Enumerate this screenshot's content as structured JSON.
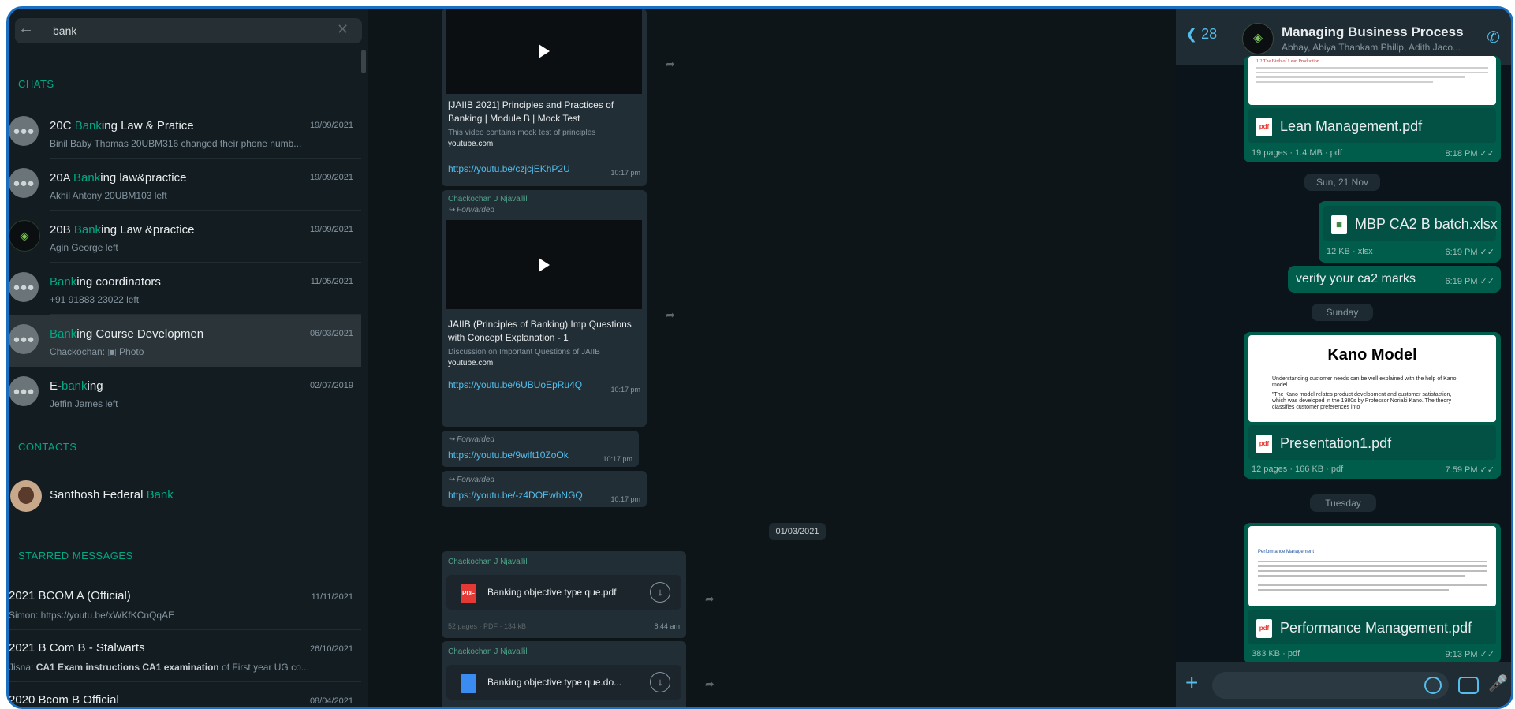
{
  "colors": {
    "accent": "#00a884",
    "link": "#53bdeb",
    "frame": "#1a6fc0",
    "outgoing": "#005c4b"
  },
  "search": {
    "query": "bank"
  },
  "sections": {
    "chats": "CHATS",
    "contacts": "CONTACTS",
    "starred": "STARRED MESSAGES"
  },
  "chats": [
    {
      "pre": "20C ",
      "hl": "Bank",
      "post": "ing Law & Pratice",
      "sub": "Binil Baby Thomas 20UBM316 changed their phone numb...",
      "date": "19/09/2021",
      "avatar": "group-icon"
    },
    {
      "pre": "20A ",
      "hl": "Bank",
      "post": "ing law&practice",
      "sub": "Akhil Antony 20UBM103 left",
      "date": "19/09/2021",
      "avatar": "group-icon"
    },
    {
      "pre": "20B ",
      "hl": "Bank",
      "post": "ing Law &practice",
      "sub": "Agin George left",
      "date": "19/09/2021",
      "avatar": "logo-icon"
    },
    {
      "pre": "",
      "hl": "Bank",
      "post": "ing coordinators",
      "sub": "+91 91883 23022 left",
      "date": "11/05/2021",
      "avatar": "group-icon"
    },
    {
      "pre": "",
      "hl": "Bank",
      "post": "ing Course Developmen",
      "sub": "Chackochan: ▣ Photo",
      "date": "06/03/2021",
      "avatar": "group-icon"
    },
    {
      "pre": "E-",
      "hl": "bank",
      "post": "ing",
      "sub": "Jeffin James left",
      "date": "02/07/2019",
      "avatar": "group-icon"
    }
  ],
  "contacts": [
    {
      "pre": "Santhosh Federal ",
      "hl": "Bank"
    }
  ],
  "starred": [
    {
      "title": "2021 BCOM A (Official)",
      "sub_pre": "Simon: https://youtu.be/xWKfKCnQqAE",
      "sub_bold": "",
      "sub_post": "",
      "date": "11/11/2021"
    },
    {
      "title": "2021 B Com B - Stalwarts",
      "sub_pre": "Jisna: ",
      "sub_bold": "CA1 Exam instructions  CA1 examination",
      "sub_post": " of First year UG co...",
      "date": "26/10/2021"
    },
    {
      "title": "2020 Bcom B Official",
      "sub_pre": "",
      "sub_bold": "",
      "sub_post": "",
      "date": "08/04/2021"
    }
  ],
  "middle": {
    "msg1": {
      "title": "[JAIIB 2021] Principles and Practices of Banking | Module B | Mock Test",
      "desc": "This video contains mock test of principles",
      "site": "youtube.com",
      "link": "https://youtu.be/czjcjEKhP2U",
      "time": "10:17 pm"
    },
    "msg2": {
      "sender": "Chackochan J Njavallil",
      "forwarded": "↪ Forwarded",
      "title": "JAIIB (Principles of Banking) Imp Questions with Concept Explanation - 1",
      "desc": "Discussion on Important Questions of JAIIB",
      "site": "youtube.com",
      "link": "https://youtu.be/6UBUoEpRu4Q",
      "time": "10:17 pm"
    },
    "msg3": {
      "forwarded": "↪ Forwarded",
      "link": "https://youtu.be/9wift10ZoOk",
      "time": "10:17 pm"
    },
    "msg4": {
      "forwarded": "↪ Forwarded",
      "link": "https://youtu.be/-z4DOEwhNGQ",
      "time": "10:17 pm"
    },
    "date_chip": "01/03/2021",
    "doc1": {
      "sender": "Chackochan J Njavallil",
      "icon": "PDF",
      "name": "Banking objective type que.pdf",
      "meta": "52 pages · PDF · 134 kB",
      "time": "8:44 am"
    },
    "doc2": {
      "sender": "Chackochan J Njavallil",
      "name": "Banking objective type que.do..."
    }
  },
  "phone": {
    "back_count": "28",
    "title": "Managing Business Process",
    "members": "Abhay, Abiya Thankam Philip, Adith Jaco...",
    "lean_preview_title": "1.2 The Birth of Lean Production",
    "lean": {
      "name": "Lean Management.pdf",
      "meta": "19 pages · 1.4 MB · pdf",
      "time": "8:18 PM ✓✓"
    },
    "chip1": "Sun, 21 Nov",
    "xlsx": {
      "name": "MBP CA2 B batch.xlsx",
      "meta": "12 KB · xlsx",
      "time": "6:19 PM ✓✓"
    },
    "text_msg": {
      "text": "verify your ca2 marks",
      "time": "6:19 PM ✓✓"
    },
    "chip2": "Sunday",
    "kano": {
      "heading": "Kano Model",
      "body1": "Understanding customer needs can be well explained with the help of Kano model.",
      "body2": "\"The Kano model relates product development and customer satisfaction, which was developed in the 1980s by Professor Noriaki Kano. The theory classifies customer preferences into",
      "name": "Presentation1.pdf",
      "meta": "12 pages · 166 KB · pdf",
      "time": "7:59 PM ✓✓"
    },
    "chip3": "Tuesday",
    "perf": {
      "heading": "Performance Management",
      "name": "Performance Management.pdf",
      "meta": "383 KB · pdf",
      "time": "9:13 PM ✓✓"
    }
  }
}
